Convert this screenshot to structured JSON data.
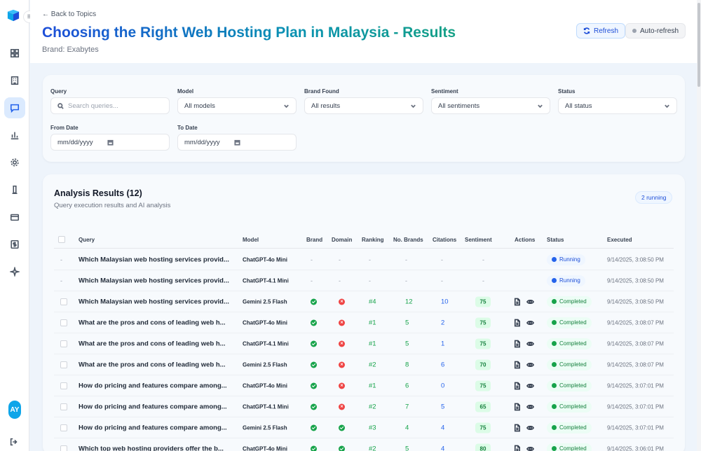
{
  "nav": {
    "items": [
      {
        "name": "dashboard-icon"
      },
      {
        "name": "building-icon"
      },
      {
        "name": "chat-icon",
        "active": true
      },
      {
        "name": "bar-chart-icon"
      },
      {
        "name": "gear-icon"
      },
      {
        "name": "flask-icon"
      },
      {
        "name": "credit-card-icon"
      },
      {
        "name": "dollar-icon"
      },
      {
        "name": "sparkle-icon"
      }
    ],
    "avatar_initials": "AY"
  },
  "header": {
    "back_link": "← Back to Topics",
    "title": "Choosing the Right Web Hosting Plan in Malaysia - Results",
    "brand": "Brand: Exabytes",
    "refresh_label": "Refresh",
    "auto_refresh_label": "Auto-refresh"
  },
  "filters": {
    "query_label": "Query",
    "query_placeholder": "Search queries...",
    "model_label": "Model",
    "model_value": "All models",
    "brand_found_label": "Brand Found",
    "brand_found_value": "All results",
    "sentiment_label": "Sentiment",
    "sentiment_value": "All sentiments",
    "status_label": "Status",
    "status_value": "All status",
    "from_date_label": "From Date",
    "from_date_value": "mm/dd/yyyy",
    "to_date_label": "To Date",
    "to_date_value": "mm/dd/yyyy"
  },
  "results": {
    "title": "Analysis Results (12)",
    "subtitle": "Query execution results and AI analysis",
    "running_badge": "2 running",
    "columns": {
      "query": "Query",
      "model": "Model",
      "brand": "Brand",
      "domain": "Domain",
      "ranking": "Ranking",
      "no_brands": "No. Brands",
      "citations": "Citations",
      "sentiment": "Sentiment",
      "actions": "Actions",
      "status": "Status",
      "executed": "Executed"
    },
    "rows": [
      {
        "query": "Which Malaysian web hosting services provid...",
        "model": "ChatGPT-4o Mini",
        "brand": "-",
        "domain": "-",
        "ranking": "-",
        "no_brands": "-",
        "citations": "-",
        "sentiment": "-",
        "status": "Running",
        "executed": "9/14/2025, 3:08:50 PM"
      },
      {
        "query": "Which Malaysian web hosting services provid...",
        "model": "ChatGPT-4.1 Mini",
        "brand": "-",
        "domain": "-",
        "ranking": "-",
        "no_brands": "-",
        "citations": "-",
        "sentiment": "-",
        "status": "Running",
        "executed": "9/14/2025, 3:08:50 PM"
      },
      {
        "query": "Which Malaysian web hosting services provid...",
        "model": "Gemini 2.5 Flash",
        "brand": "yes",
        "domain": "no",
        "ranking": "#4",
        "no_brands": "12",
        "citations": "10",
        "sentiment": "75",
        "status": "Completed",
        "executed": "9/14/2025, 3:08:50 PM"
      },
      {
        "query": "What are the pros and cons of leading web h...",
        "model": "ChatGPT-4o Mini",
        "brand": "yes",
        "domain": "no",
        "ranking": "#1",
        "no_brands": "5",
        "citations": "2",
        "sentiment": "75",
        "status": "Completed",
        "executed": "9/14/2025, 3:08:07 PM"
      },
      {
        "query": "What are the pros and cons of leading web h...",
        "model": "ChatGPT-4.1 Mini",
        "brand": "yes",
        "domain": "no",
        "ranking": "#1",
        "no_brands": "5",
        "citations": "1",
        "sentiment": "75",
        "status": "Completed",
        "executed": "9/14/2025, 3:08:07 PM"
      },
      {
        "query": "What are the pros and cons of leading web h...",
        "model": "Gemini 2.5 Flash",
        "brand": "yes",
        "domain": "no",
        "ranking": "#2",
        "no_brands": "8",
        "citations": "6",
        "sentiment": "70",
        "status": "Completed",
        "executed": "9/14/2025, 3:08:07 PM"
      },
      {
        "query": "How do pricing and features compare among...",
        "model": "ChatGPT-4o Mini",
        "brand": "yes",
        "domain": "no",
        "ranking": "#1",
        "no_brands": "6",
        "citations": "0",
        "sentiment": "75",
        "status": "Completed",
        "executed": "9/14/2025, 3:07:01 PM"
      },
      {
        "query": "How do pricing and features compare among...",
        "model": "ChatGPT-4.1 Mini",
        "brand": "yes",
        "domain": "no",
        "ranking": "#2",
        "no_brands": "7",
        "citations": "5",
        "sentiment": "65",
        "status": "Completed",
        "executed": "9/14/2025, 3:07:01 PM"
      },
      {
        "query": "How do pricing and features compare among...",
        "model": "Gemini 2.5 Flash",
        "brand": "yes",
        "domain": "yes",
        "ranking": "#3",
        "no_brands": "4",
        "citations": "4",
        "sentiment": "75",
        "status": "Completed",
        "executed": "9/14/2025, 3:07:01 PM"
      },
      {
        "query": "Which top web hosting providers offer the b...",
        "model": "ChatGPT-4o Mini",
        "brand": "yes",
        "domain": "yes",
        "ranking": "#2",
        "no_brands": "5",
        "citations": "4",
        "sentiment": "80",
        "status": "Completed",
        "executed": "9/14/2025, 3:06:01 PM"
      }
    ]
  }
}
